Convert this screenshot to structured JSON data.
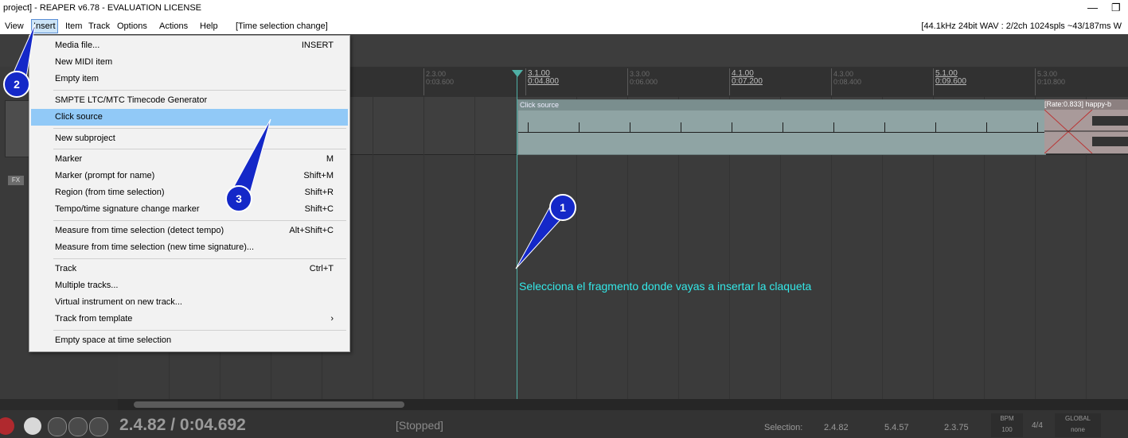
{
  "window": {
    "title": "project] - REAPER v6.78 - EVALUATION LICENSE",
    "minimize": "—",
    "restore": "❐"
  },
  "menubar": {
    "items": [
      "View",
      "Insert",
      "Item",
      "Track",
      "Options",
      "Actions",
      "Help",
      "[Time selection change]"
    ],
    "status": "[44.1kHz 24bit WAV : 2/2ch 1024spls ~43/187ms W"
  },
  "ruler": {
    "labels": [
      {
        "bar": "2.3.00",
        "time": "0:03.600",
        "major": false
      },
      {
        "bar": "3.1.00",
        "time": "0:04.800",
        "major": true
      },
      {
        "bar": "3.3.00",
        "time": "0:06.000",
        "major": false
      },
      {
        "bar": "4.1.00",
        "time": "0:07.200",
        "major": true
      },
      {
        "bar": "4.3.00",
        "time": "0:08.400",
        "major": false
      },
      {
        "bar": "5.1.00",
        "time": "0:09.600",
        "major": true
      },
      {
        "bar": "5.3.00",
        "time": "0:10.800",
        "major": false
      }
    ]
  },
  "track": {
    "fx_label": "FX"
  },
  "items": {
    "click_source": "Click source",
    "audio": "[Rate:0.833] happy-b"
  },
  "insert_menu": {
    "entries": [
      {
        "label": "Media file...",
        "shortcut": "INSERT"
      },
      {
        "label": "New MIDI item",
        "shortcut": ""
      },
      {
        "label": "Empty item",
        "shortcut": ""
      },
      {
        "label": "SMPTE LTC/MTC Timecode Generator",
        "shortcut": ""
      },
      {
        "label": "Click source",
        "shortcut": ""
      },
      {
        "label": "New subproject",
        "shortcut": ""
      },
      {
        "label": "Marker",
        "shortcut": "M"
      },
      {
        "label": "Marker (prompt for name)",
        "shortcut": "Shift+M"
      },
      {
        "label": "Region (from time selection)",
        "shortcut": "Shift+R"
      },
      {
        "label": "Tempo/time signature change marker",
        "shortcut": "Shift+C"
      },
      {
        "label": "Measure from time selection (detect tempo)",
        "shortcut": "Alt+Shift+C"
      },
      {
        "label": "Measure from time selection (new time signature)...",
        "shortcut": ""
      },
      {
        "label": "Track",
        "shortcut": "Ctrl+T"
      },
      {
        "label": "Multiple tracks...",
        "shortcut": ""
      },
      {
        "label": "Virtual instrument on new track...",
        "shortcut": ""
      },
      {
        "label": "Track from template",
        "shortcut": "›"
      },
      {
        "label": "Empty space at time selection",
        "shortcut": ""
      }
    ],
    "highlighted": "Click source"
  },
  "annotations": {
    "badges": [
      "1",
      "2",
      "3"
    ],
    "caption": "Selecciona el fragmento donde vayas a insertar la claqueta",
    "color": "#1428c8"
  },
  "transport": {
    "position": "2.4.82 / 0:04.692",
    "state": "[Stopped]",
    "selection_label": "Selection:",
    "selection_start": "2.4.82",
    "selection_end": "5.4.57",
    "selection_length": "2.3.75",
    "bpm_label": "BPM",
    "bpm": "100",
    "time_signature": "4/4",
    "global_label": "GLOBAL",
    "global_value": "none"
  }
}
